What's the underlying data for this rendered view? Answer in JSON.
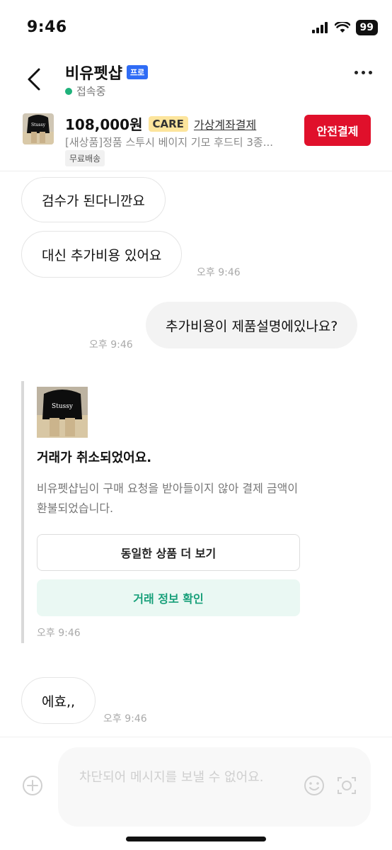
{
  "status_bar": {
    "time": "9:46",
    "battery": "99"
  },
  "header": {
    "shop_name": "비유펫샵",
    "badge": "프로",
    "presence": "접속중"
  },
  "product": {
    "price": "108,000원",
    "care_badge": "CARE",
    "pay_method": "가상계좌결제",
    "title": "[새상품]정품 스투시 베이지 기모 후드티 3종...",
    "shipping": "무료배송",
    "pay_button": "안전결제"
  },
  "messages": [
    {
      "text": "검수가 된다니깐요"
    },
    {
      "text": "대신 추가비용 있어요",
      "time": "오후 9:46"
    },
    {
      "text": "추가비용이 제품설명에있나요?",
      "time": "오후 9:46"
    }
  ],
  "system_card": {
    "title": "거래가 취소되었어요.",
    "description": "비유펫샵님이 구매 요청을 받아들이지 않아 결제 금액이 환불되었습니다.",
    "button_more": "동일한 상품 더 보기",
    "button_info": "거래 정보 확인",
    "time": "오후 9:46"
  },
  "last_message": {
    "text": "에효,,",
    "time": "오후 9:46"
  },
  "input": {
    "placeholder": "차단되어 메시지를 보낼 수 없어요."
  }
}
